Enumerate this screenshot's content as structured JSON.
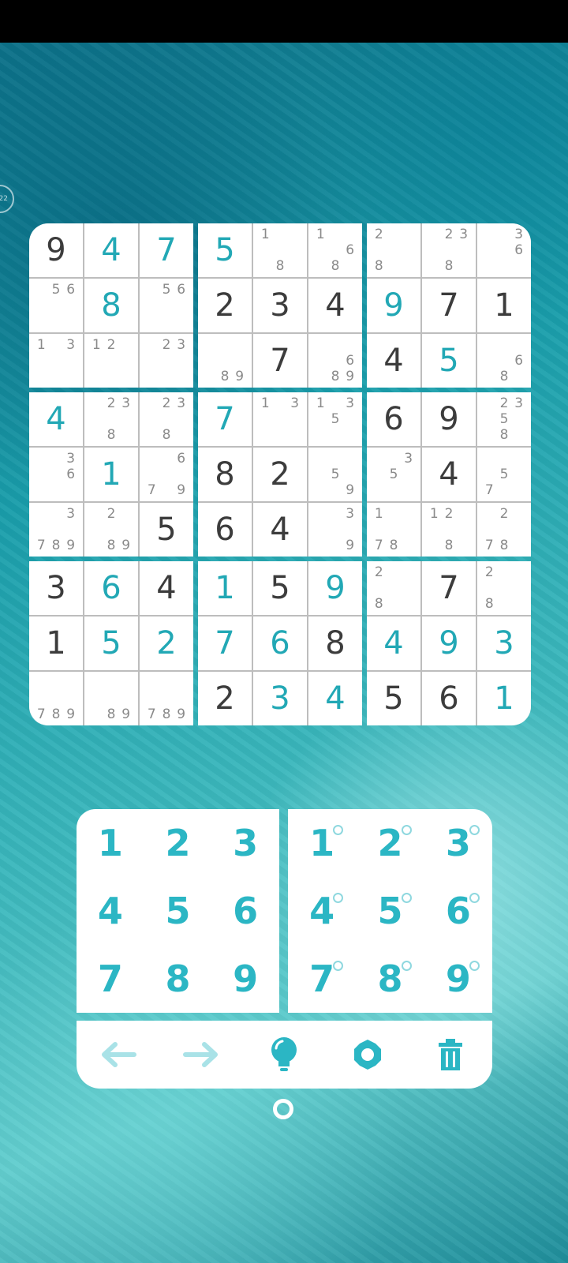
{
  "timer_badge": "22",
  "colors": {
    "accent": "#2bb6c4",
    "given": "#3c3c3c",
    "note": "#8a8a8a",
    "disabled": "#a9e2e7"
  },
  "board": [
    [
      [
        {
          "v": "9",
          "t": "given"
        },
        {
          "v": "4",
          "t": "user"
        },
        {
          "v": "7",
          "t": "user"
        },
        {
          "n": [
            "5",
            "6"
          ],
          "p": [
            1,
            2
          ]
        },
        {
          "v": "8",
          "t": "user"
        },
        {
          "n": [
            "5",
            "6"
          ],
          "p": [
            1,
            2
          ]
        },
        {
          "n": [
            "1",
            "3"
          ],
          "p": [
            0,
            2
          ]
        },
        {
          "n": [
            "1",
            "2"
          ],
          "p": [
            0,
            1
          ]
        },
        {
          "n": [
            "2",
            "3"
          ],
          "p": [
            1,
            2
          ]
        }
      ],
      [
        {
          "v": "5",
          "t": "user"
        },
        {
          "n": [
            "1",
            "8"
          ],
          "p": [
            0,
            7
          ]
        },
        {
          "n": [
            "1",
            "6",
            "8"
          ],
          "p": [
            0,
            5,
            7
          ]
        },
        {
          "v": "2",
          "t": "given"
        },
        {
          "v": "3",
          "t": "given"
        },
        {
          "v": "4",
          "t": "given"
        },
        {
          "n": [
            "8",
            "9"
          ],
          "p": [
            7,
            8
          ]
        },
        {
          "v": "7",
          "t": "given"
        },
        {
          "n": [
            "6",
            "8",
            "9"
          ],
          "p": [
            5,
            7,
            8
          ]
        }
      ],
      [
        {
          "n": [
            "2",
            "8"
          ],
          "p": [
            0,
            6
          ]
        },
        {
          "n": [
            "2",
            "3",
            "8"
          ],
          "p": [
            1,
            2,
            7
          ]
        },
        {
          "n": [
            "3",
            "6"
          ],
          "p": [
            2,
            5
          ]
        },
        {
          "v": "9",
          "t": "user"
        },
        {
          "v": "7",
          "t": "given"
        },
        {
          "v": "1",
          "t": "given"
        },
        {
          "v": "4",
          "t": "given"
        },
        {
          "v": "5",
          "t": "user"
        },
        {
          "n": [
            "6",
            "8"
          ],
          "p": [
            5,
            7
          ]
        }
      ]
    ],
    [
      [
        {
          "v": "4",
          "t": "user"
        },
        {
          "n": [
            "2",
            "3",
            "8"
          ],
          "p": [
            1,
            2,
            7
          ]
        },
        {
          "n": [
            "2",
            "3",
            "8"
          ],
          "p": [
            1,
            2,
            7
          ]
        },
        {
          "n": [
            "3",
            "6"
          ],
          "p": [
            2,
            5
          ]
        },
        {
          "v": "1",
          "t": "user"
        },
        {
          "n": [
            "6",
            "7",
            "9"
          ],
          "p": [
            2,
            6,
            8
          ]
        },
        {
          "n": [
            "3",
            "7",
            "8",
            "9"
          ],
          "p": [
            2,
            6,
            7,
            8
          ]
        },
        {
          "n": [
            "2",
            "8",
            "9"
          ],
          "p": [
            1,
            7,
            8
          ]
        },
        {
          "v": "5",
          "t": "given"
        }
      ],
      [
        {
          "v": "7",
          "t": "user"
        },
        {
          "n": [
            "1",
            "3"
          ],
          "p": [
            0,
            2
          ]
        },
        {
          "n": [
            "1",
            "3",
            "5"
          ],
          "p": [
            0,
            2,
            4
          ]
        },
        {
          "v": "8",
          "t": "given"
        },
        {
          "v": "2",
          "t": "given"
        },
        {
          "n": [
            "5",
            "9"
          ],
          "p": [
            4,
            8
          ]
        },
        {
          "v": "6",
          "t": "given"
        },
        {
          "v": "4",
          "t": "given"
        },
        {
          "n": [
            "3",
            "9"
          ],
          "p": [
            2,
            8
          ]
        }
      ],
      [
        {
          "v": "6",
          "t": "given"
        },
        {
          "v": "9",
          "t": "given"
        },
        {
          "n": [
            "2",
            "3",
            "5",
            "8"
          ],
          "p": [
            1,
            2,
            4,
            7
          ]
        },
        {
          "n": [
            "3",
            "5"
          ],
          "p": [
            2,
            4
          ]
        },
        {
          "v": "4",
          "t": "given"
        },
        {
          "n": [
            "5",
            "7"
          ],
          "p": [
            4,
            6
          ]
        },
        {
          "n": [
            "1",
            "7",
            "8"
          ],
          "p": [
            0,
            6,
            7
          ]
        },
        {
          "n": [
            "1",
            "2",
            "8"
          ],
          "p": [
            0,
            1,
            7
          ]
        },
        {
          "n": [
            "2",
            "7",
            "8"
          ],
          "p": [
            1,
            6,
            7
          ]
        }
      ]
    ],
    [
      [
        {
          "v": "3",
          "t": "given"
        },
        {
          "v": "6",
          "t": "user"
        },
        {
          "v": "4",
          "t": "given"
        },
        {
          "v": "1",
          "t": "given"
        },
        {
          "v": "5",
          "t": "user"
        },
        {
          "v": "2",
          "t": "user"
        },
        {
          "n": [
            "7",
            "8",
            "9"
          ],
          "p": [
            6,
            7,
            8
          ]
        },
        {
          "n": [
            "8",
            "9"
          ],
          "p": [
            7,
            8
          ]
        },
        {
          "n": [
            "7",
            "8",
            "9"
          ],
          "p": [
            6,
            7,
            8
          ]
        }
      ],
      [
        {
          "v": "1",
          "t": "user"
        },
        {
          "v": "5",
          "t": "given"
        },
        {
          "v": "9",
          "t": "user"
        },
        {
          "v": "7",
          "t": "user"
        },
        {
          "v": "6",
          "t": "user"
        },
        {
          "v": "8",
          "t": "given"
        },
        {
          "v": "2",
          "t": "given"
        },
        {
          "v": "3",
          "t": "user"
        },
        {
          "v": "4",
          "t": "user"
        }
      ],
      [
        {
          "n": [
            "2",
            "8"
          ],
          "p": [
            0,
            6
          ]
        },
        {
          "v": "7",
          "t": "given"
        },
        {
          "n": [
            "2",
            "8"
          ],
          "p": [
            0,
            6
          ]
        },
        {
          "v": "4",
          "t": "user"
        },
        {
          "v": "9",
          "t": "user"
        },
        {
          "v": "3",
          "t": "user"
        },
        {
          "v": "5",
          "t": "given"
        },
        {
          "v": "6",
          "t": "given"
        },
        {
          "v": "1",
          "t": "user"
        }
      ]
    ]
  ],
  "numpad": {
    "value_keys": [
      "1",
      "2",
      "3",
      "4",
      "5",
      "6",
      "7",
      "8",
      "9"
    ],
    "note_keys": [
      "1",
      "2",
      "3",
      "4",
      "5",
      "6",
      "7",
      "8",
      "9"
    ]
  },
  "toolbar": [
    {
      "name": "undo-arrow-icon",
      "enabled": false
    },
    {
      "name": "redo-arrow-icon",
      "enabled": false
    },
    {
      "name": "hint-bulb-icon",
      "enabled": true
    },
    {
      "name": "settings-gear-icon",
      "enabled": true
    },
    {
      "name": "delete-trash-icon",
      "enabled": true
    }
  ]
}
